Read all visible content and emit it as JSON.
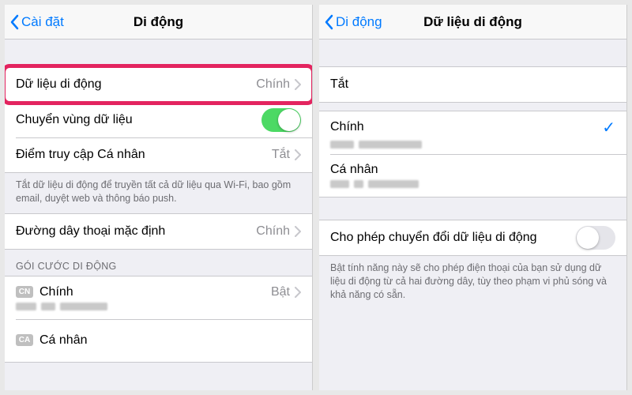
{
  "left": {
    "nav": {
      "back": "Cài đặt",
      "title": "Di động"
    },
    "row_data": {
      "label": "Dữ liệu di động",
      "value": "Chính"
    },
    "row_roaming": {
      "label": "Chuyển vùng dữ liệu",
      "on": true
    },
    "row_hotspot": {
      "label": "Điểm truy cập Cá nhân",
      "value": "Tắt"
    },
    "note1": "Tắt dữ liệu di động để truyền tất cả dữ liệu qua Wi-Fi, bao gồm email, duyệt web và thông báo push.",
    "row_defaultvoice": {
      "label": "Đường dây thoại mặc định",
      "value": "Chính"
    },
    "plans_header": "GÓI CƯỚC DI ĐỘNG",
    "plan1": {
      "sim": "CN",
      "label": "Chính",
      "value": "Bật"
    },
    "plan2": {
      "sim": "CA",
      "label": "Cá nhân",
      "value": ""
    }
  },
  "right": {
    "nav": {
      "back": "Di động",
      "title": "Dữ liệu di động"
    },
    "row_off": {
      "label": "Tắt"
    },
    "opt_primary": {
      "label": "Chính",
      "selected": true
    },
    "opt_personal": {
      "label": "Cá nhân",
      "selected": false
    },
    "row_switch": {
      "label": "Cho phép chuyển đổi dữ liệu di động",
      "on": false
    },
    "note2": "Bật tính năng này sẽ cho phép điện thoại của bạn sử dụng dữ liệu di động từ cả hai đường dây, tùy theo phạm vi phủ sóng và khả năng có sẵn."
  }
}
